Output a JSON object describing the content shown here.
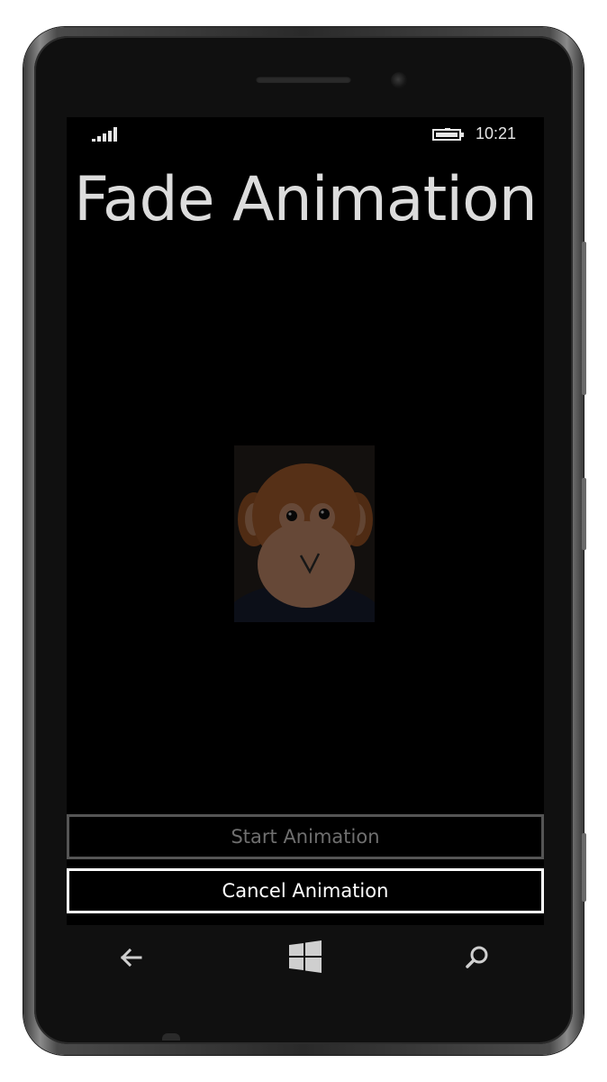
{
  "status_bar": {
    "time": "10:21",
    "signal_icon": "signal-strength-icon",
    "battery_icon": "battery-charging-icon"
  },
  "page": {
    "title": "Fade Animation",
    "image_icon": "monkey-photo"
  },
  "buttons": {
    "start_label": "Start Animation",
    "start_enabled": false,
    "cancel_label": "Cancel Animation",
    "cancel_enabled": true
  },
  "nav_bar": {
    "back_icon": "back-arrow-icon",
    "start_icon": "windows-logo-icon",
    "search_icon": "search-icon"
  },
  "colors": {
    "screen_background": "#000000",
    "title_text": "#dcdcdc",
    "button_border_active": "#ffffff",
    "button_border_disabled": "#555555"
  }
}
